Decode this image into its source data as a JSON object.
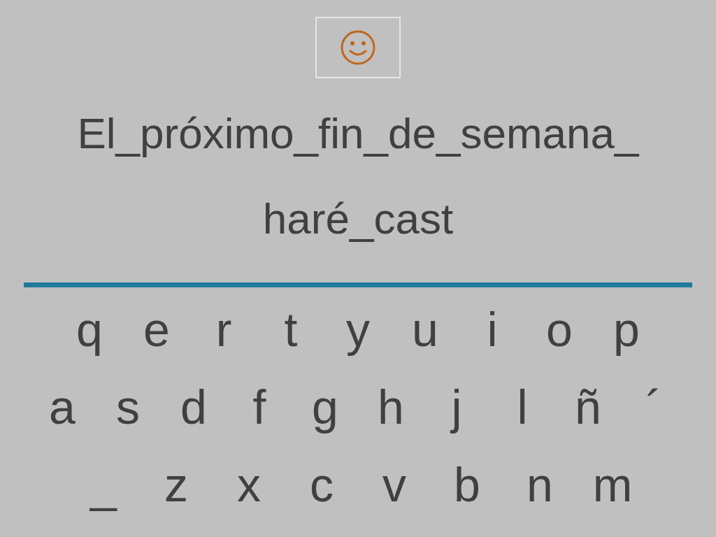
{
  "sentence_lines": [
    "El_próximo_fin_de_semana_",
    "haré_cast"
  ],
  "keyboard": {
    "rows": [
      [
        "q",
        "e",
        "r",
        "t",
        "y",
        "u",
        "i",
        "o",
        "p"
      ],
      [
        "a",
        "s",
        "d",
        "f",
        "g",
        "h",
        "j",
        "l",
        "ñ",
        "´"
      ],
      [
        "_",
        "z",
        "x",
        "c",
        "v",
        "b",
        "n",
        "m"
      ]
    ]
  }
}
